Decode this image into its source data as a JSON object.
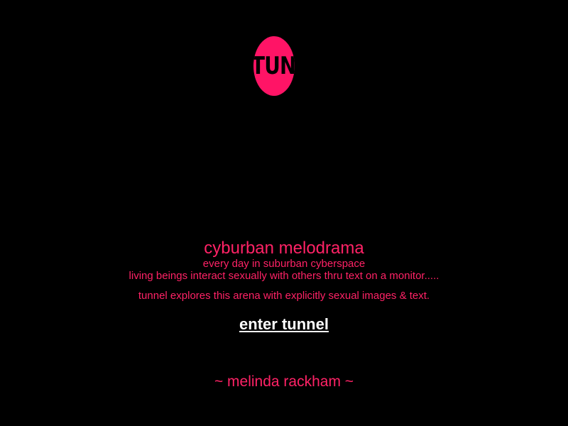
{
  "logo": {
    "text": "TUNNEL",
    "color": "#ff1466"
  },
  "intro": {
    "title": "cyburban melodrama",
    "line1": "every day in suburban cyberspace",
    "line2": "living beings interact sexually with others thru text on a monitor.....",
    "line3": "tunnel explores this arena with explicitly sexual images & text."
  },
  "enter_link": {
    "label": "enter tunnel"
  },
  "author": {
    "label": "~ melinda rackham ~"
  },
  "colors": {
    "background": "#000000",
    "accent": "#ff2266",
    "link": "#ffffff"
  }
}
